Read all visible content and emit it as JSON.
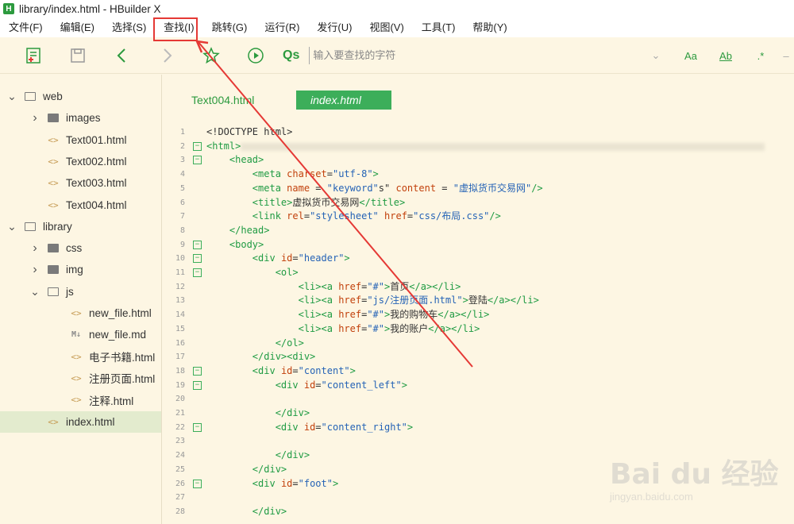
{
  "window": {
    "title": "library/index.html - HBuilder X",
    "logo_letter": "H"
  },
  "menu": [
    "文件(F)",
    "编辑(E)",
    "选择(S)",
    "查找(I)",
    "跳转(G)",
    "运行(R)",
    "发行(U)",
    "视图(V)",
    "工具(T)",
    "帮助(Y)"
  ],
  "toolbar": {
    "search_placeholder": "输入要查找的字符",
    "search_icon_text": "Qs",
    "match_case_label": "Aa",
    "whole_word_label": "Ab",
    "regex_label": ".*"
  },
  "sidebar": {
    "items": [
      {
        "label": "web",
        "kind": "project",
        "expanded": true,
        "indent": 0
      },
      {
        "label": "images",
        "kind": "folder",
        "expanded": false,
        "indent": 1
      },
      {
        "label": "Text001.html",
        "kind": "html",
        "indent": 1
      },
      {
        "label": "Text002.html",
        "kind": "html",
        "indent": 1
      },
      {
        "label": "Text003.html",
        "kind": "html",
        "indent": 1
      },
      {
        "label": "Text004.html",
        "kind": "html",
        "indent": 1
      },
      {
        "label": "library",
        "kind": "project",
        "expanded": true,
        "indent": 0
      },
      {
        "label": "css",
        "kind": "folder",
        "expanded": false,
        "indent": 1
      },
      {
        "label": "img",
        "kind": "folder",
        "expanded": false,
        "indent": 1
      },
      {
        "label": "js",
        "kind": "folder",
        "expanded": true,
        "indent": 1
      },
      {
        "label": "new_file.html",
        "kind": "html",
        "indent": 2
      },
      {
        "label": "new_file.md",
        "kind": "md",
        "indent": 2
      },
      {
        "label": "电子书籍.html",
        "kind": "html",
        "indent": 2
      },
      {
        "label": "注册页面.html",
        "kind": "html",
        "indent": 2
      },
      {
        "label": "注释.html",
        "kind": "html",
        "indent": 2
      },
      {
        "label": "index.html",
        "kind": "html",
        "indent": 1,
        "active": true
      }
    ]
  },
  "tabs": {
    "inactive": "Text004.html",
    "active": "index.html"
  },
  "code_lines": [
    {
      "n": "1",
      "fold": false,
      "html": "<span class=\"txt\">&lt;!DOCTYPE html&gt;</span>"
    },
    {
      "n": "2",
      "fold": true,
      "html": "<span class=\"tag\">&lt;html&gt;</span>"
    },
    {
      "n": "3",
      "fold": true,
      "html": "    <span class=\"tag\">&lt;head&gt;</span>"
    },
    {
      "n": "4",
      "fold": false,
      "html": "        <span class=\"tag\">&lt;meta</span> <span class=\"attr\">charset</span>=<span class=\"str\">\"utf-8\"</span><span class=\"tag\">&gt;</span>"
    },
    {
      "n": "5",
      "fold": false,
      "html": "        <span class=\"tag\">&lt;meta</span> <span class=\"attr\">name</span> = <span class=\"str\">\"keyword\"</span>s\" <span class=\"attr\">content</span> = <span class=\"str\">\"虚拟货币交易网\"</span><span class=\"tag\">/&gt;</span>"
    },
    {
      "n": "6",
      "fold": false,
      "html": "        <span class=\"tag\">&lt;title&gt;</span>虚拟货币交易网<span class=\"tag\">&lt;/title&gt;</span>"
    },
    {
      "n": "7",
      "fold": false,
      "html": "        <span class=\"tag\">&lt;link</span> <span class=\"attr\">rel</span>=<span class=\"str\">\"stylesheet\"</span> <span class=\"attr\">href</span>=<span class=\"str\">\"css/布局.css\"</span><span class=\"tag\">/&gt;</span>"
    },
    {
      "n": "8",
      "fold": false,
      "html": "    <span class=\"tag\">&lt;/head&gt;</span>"
    },
    {
      "n": "9",
      "fold": true,
      "html": "    <span class=\"tag\">&lt;body&gt;</span>"
    },
    {
      "n": "10",
      "fold": true,
      "html": "        <span class=\"tag\">&lt;div</span> <span class=\"attr\">id</span>=<span class=\"str\">\"header\"</span><span class=\"tag\">&gt;</span>"
    },
    {
      "n": "11",
      "fold": true,
      "html": "            <span class=\"tag\">&lt;ol&gt;</span>"
    },
    {
      "n": "12",
      "fold": false,
      "html": "                <span class=\"tag\">&lt;li&gt;&lt;a</span> <span class=\"attr\">href</span>=<span class=\"str\">\"#\"</span><span class=\"tag\">&gt;</span>首页<span class=\"tag\">&lt;/a&gt;&lt;/li&gt;</span>"
    },
    {
      "n": "13",
      "fold": false,
      "html": "                <span class=\"tag\">&lt;li&gt;&lt;a</span> <span class=\"attr\">href</span>=<span class=\"str\">\"js/注册页面.html\"</span><span class=\"tag\">&gt;</span>登陆<span class=\"tag\">&lt;/a&gt;&lt;/li&gt;</span>"
    },
    {
      "n": "14",
      "fold": false,
      "html": "                <span class=\"tag\">&lt;li&gt;&lt;a</span> <span class=\"attr\">href</span>=<span class=\"str\">\"#\"</span><span class=\"tag\">&gt;</span>我的购物车<span class=\"tag\">&lt;/a&gt;&lt;/li&gt;</span>"
    },
    {
      "n": "15",
      "fold": false,
      "html": "                <span class=\"tag\">&lt;li&gt;&lt;a</span> <span class=\"attr\">href</span>=<span class=\"str\">\"#\"</span><span class=\"tag\">&gt;</span>我的账户<span class=\"tag\">&lt;/a&gt;&lt;/li&gt;</span>"
    },
    {
      "n": "16",
      "fold": false,
      "html": "            <span class=\"tag\">&lt;/ol&gt;</span>"
    },
    {
      "n": "17",
      "fold": false,
      "html": "        <span class=\"tag\">&lt;/div&gt;&lt;div&gt;</span>"
    },
    {
      "n": "18",
      "fold": true,
      "html": "        <span class=\"tag\">&lt;div</span> <span class=\"attr\">id</span>=<span class=\"str\">\"content\"</span><span class=\"tag\">&gt;</span>"
    },
    {
      "n": "19",
      "fold": true,
      "html": "            <span class=\"tag\">&lt;div</span> <span class=\"attr\">id</span>=<span class=\"str\">\"content_left\"</span><span class=\"tag\">&gt;</span>"
    },
    {
      "n": "20",
      "fold": false,
      "html": ""
    },
    {
      "n": "21",
      "fold": false,
      "html": "            <span class=\"tag\">&lt;/div&gt;</span>"
    },
    {
      "n": "22",
      "fold": true,
      "html": "            <span class=\"tag\">&lt;div</span> <span class=\"attr\">id</span>=<span class=\"str\">\"content_right\"</span><span class=\"tag\">&gt;</span>"
    },
    {
      "n": "23",
      "fold": false,
      "html": ""
    },
    {
      "n": "24",
      "fold": false,
      "html": "            <span class=\"tag\">&lt;/div&gt;</span>"
    },
    {
      "n": "25",
      "fold": false,
      "html": "        <span class=\"tag\">&lt;/div&gt;</span>"
    },
    {
      "n": "26",
      "fold": true,
      "html": "        <span class=\"tag\">&lt;div</span> <span class=\"attr\">id</span>=<span class=\"str\">\"foot\"</span><span class=\"tag\">&gt;</span>"
    },
    {
      "n": "27",
      "fold": false,
      "html": ""
    },
    {
      "n": "28",
      "fold": false,
      "html": "        <span class=\"tag\">&lt;/div&gt;</span>"
    }
  ],
  "watermark": {
    "main": "Bai du 经验",
    "sub": "jingyan.baidu.com"
  },
  "colors": {
    "accent": "#3cae5a",
    "annotation": "#e53935",
    "background": "#fdf6e3"
  }
}
